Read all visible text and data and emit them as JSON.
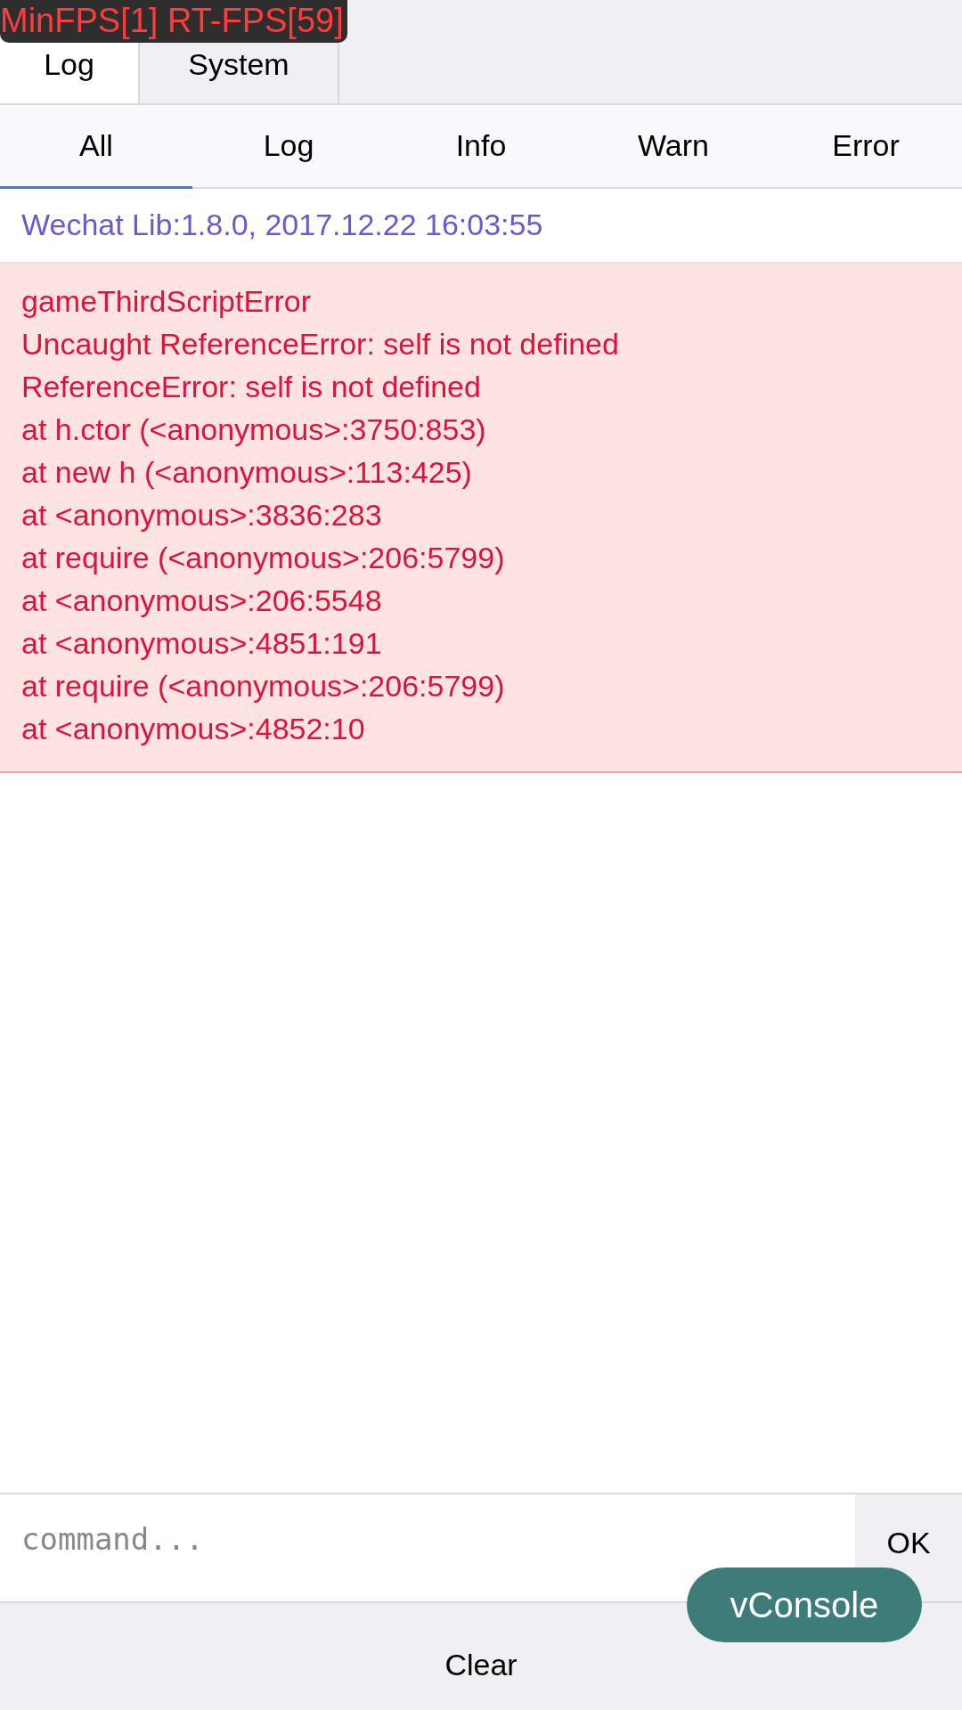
{
  "fps_overlay": {
    "text": "MinFPS[1] RT-FPS[59]"
  },
  "tabs": [
    {
      "label": "Log",
      "selected": true
    },
    {
      "label": "System",
      "selected": false
    }
  ],
  "filters": [
    {
      "label": "All",
      "selected": true
    },
    {
      "label": "Log",
      "selected": false
    },
    {
      "label": "Info",
      "selected": false
    },
    {
      "label": "Warn",
      "selected": false
    },
    {
      "label": "Error",
      "selected": false
    }
  ],
  "logs": [
    {
      "kind": "info",
      "lines": [
        "Wechat Lib:1.8.0, 2017.12.22 16:03:55"
      ]
    },
    {
      "kind": "error",
      "lines": [
        "gameThirdScriptError",
        "Uncaught ReferenceError: self is not defined",
        "ReferenceError: self is not defined",
        "at h.ctor (<anonymous>:3750:853)",
        "at new h (<anonymous>:113:425)",
        "at <anonymous>:3836:283",
        "at require (<anonymous>:206:5799)",
        "at <anonymous>:206:5548",
        "at <anonymous>:4851:191",
        "at require (<anonymous>:206:5799)",
        "at <anonymous>:4852:10"
      ]
    }
  ],
  "command": {
    "placeholder": "command...",
    "button": "OK"
  },
  "toolbar": [
    "Clear"
  ],
  "switch_button": "vConsole"
}
